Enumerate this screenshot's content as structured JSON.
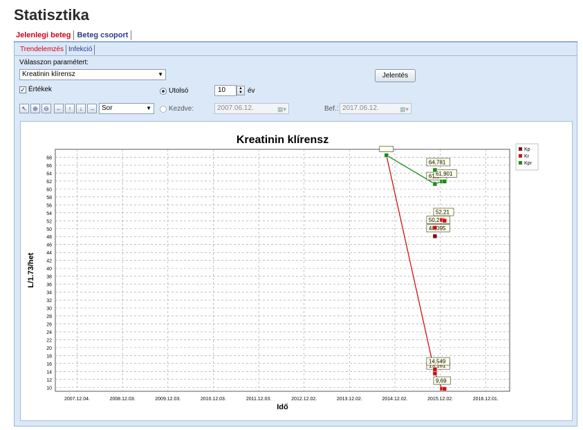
{
  "header": {
    "title": "Statisztika"
  },
  "tabs_main": [
    {
      "label": "Jelenlegi beteg",
      "active": true
    },
    {
      "label": "Beteg csoport",
      "active": false
    }
  ],
  "tabs_sub": [
    {
      "label": "Trendelemzés",
      "active": true
    },
    {
      "label": "Infekció",
      "active": false
    }
  ],
  "controls": {
    "param_label": "Válasszon paramétert:",
    "param_value": "Kreatinin klírensz",
    "report_button": "Jelentés",
    "values_checkbox": {
      "label": "Értékek",
      "checked": true
    },
    "last_radio": {
      "label": "Utolsó",
      "selected": true
    },
    "last_value": "10",
    "last_unit": "év",
    "start_radio": {
      "label": "Kezdve:",
      "selected": false
    },
    "start_date": "2007.06.12.",
    "end_label": "Bef.:",
    "end_date": "2017.06.12.",
    "chart_style": "Sor"
  },
  "toolbar_icons": [
    "cursor-icon",
    "zoom-in-icon",
    "zoom-out-icon",
    "pan-left-icon",
    "pan-up-icon",
    "pan-down-icon",
    "pan-right-icon"
  ],
  "chart_data": {
    "type": "line",
    "title": "Kreatinin klírensz",
    "xlabel": "Idő",
    "ylabel": "L/1.73/het",
    "ylim": [
      9,
      70
    ],
    "yticks": [
      10,
      12,
      14,
      16,
      18,
      20,
      22,
      24,
      26,
      28,
      30,
      32,
      34,
      36,
      38,
      40,
      42,
      44,
      46,
      48,
      50,
      52,
      54,
      56,
      58,
      60,
      62,
      64,
      66,
      68
    ],
    "xticks": [
      "2007.12.04.",
      "2008.12.03.",
      "2009.12.03.",
      "2010.12.03.",
      "2011.12.03.",
      "2012.12.02.",
      "2013.12.02.",
      "2014.12.02.",
      "2015.12.02.",
      "2016.12.01."
    ],
    "xrange": [
      "2007.06.12.",
      "2017.06.12."
    ],
    "legend_position": "top-right",
    "grid": true,
    "series": [
      {
        "name": "Kp",
        "color": "#7b0a1e",
        "line": false,
        "points": [
          {
            "x": "2015.10.20.",
            "y": 48.095,
            "label": "48,095"
          }
        ]
      },
      {
        "name": "Kr",
        "color": "#cc1111",
        "line": true,
        "points": [
          {
            "x": "2014.09.25.",
            "y": 68.5,
            "label": ""
          },
          {
            "x": "2015.10.20.",
            "y": 13.5,
            "label": "13,181"
          },
          {
            "x": "2015.12.15.",
            "y": 9.69,
            "label": "9,69"
          },
          {
            "x": "2016.01.05.",
            "y": 9.6,
            "label": ""
          }
        ]
      },
      {
        "name": "Kr",
        "color": "#cc1111",
        "line": false,
        "points": [
          {
            "x": "2015.10.20.",
            "y": 50.231,
            "label": "50,231"
          },
          {
            "x": "2015.12.15.",
            "y": 52.21,
            "label": "52,21"
          },
          {
            "x": "2016.01.05.",
            "y": 52.0,
            "label": ""
          },
          {
            "x": "2015.10.20.",
            "y": 14.549,
            "label": "14,549"
          }
        ]
      },
      {
        "name": "Kpr",
        "color": "#1a8a1a",
        "line": true,
        "points": [
          {
            "x": "2014.09.25.",
            "y": 68.5,
            "label": ""
          },
          {
            "x": "2015.10.20.",
            "y": 61.27,
            "label": "61,27"
          },
          {
            "x": "2015.12.15.",
            "y": 61.901,
            "label": "61,901"
          },
          {
            "x": "2016.01.05.",
            "y": 61.9,
            "label": ""
          }
        ]
      },
      {
        "name": "Kpr",
        "color": "#1a8a1a",
        "line": false,
        "points": [
          {
            "x": "2015.10.20.",
            "y": 64.781,
            "label": "64,781"
          }
        ]
      }
    ],
    "legend": [
      {
        "name": "Kp",
        "color": "#7b0a1e"
      },
      {
        "name": "Kr",
        "color": "#cc1111"
      },
      {
        "name": "Kpr",
        "color": "#1a8a1a"
      }
    ]
  }
}
